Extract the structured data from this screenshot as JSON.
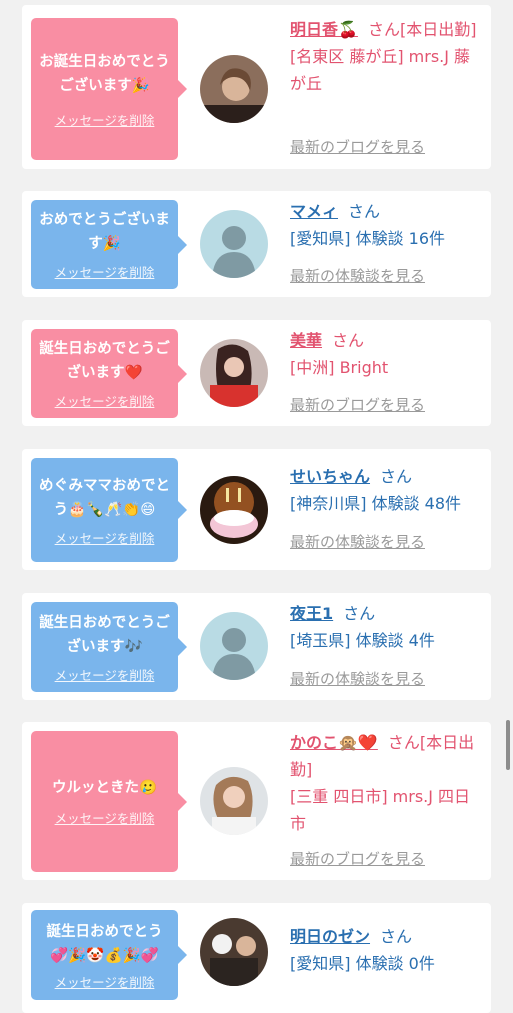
{
  "delete_label": "メッセージを削除",
  "san": "さん",
  "colors": {
    "pink_bubble": "#f98ea3",
    "blue_bubble": "#7ab5ec",
    "pink_text": "#e2536f",
    "blue_text": "#2a6fb0"
  },
  "cards": [
    {
      "message": "お誕生日おめでとうございます🎉",
      "name": "明日香🍒",
      "suffix": "[本日出勤]",
      "detail": "[名東区 藤が丘] mrs.J 藤が丘",
      "latest": "最新のブログを見る"
    },
    {
      "message": "おめでとうございます🎉",
      "name": "マメィ",
      "suffix": "",
      "detail": "[愛知県] 体験談 16件",
      "latest": "最新の体験談を見る",
      "avatar_text": "no photo"
    },
    {
      "message": "誕生日おめでとうございます❤️",
      "name": "美華",
      "suffix": "",
      "detail": "[中洲] Bright",
      "latest": "最新のブログを見る"
    },
    {
      "message": "めぐみママおめでとう🎂🍾🥂👏😄",
      "name": "せいちゃん",
      "suffix": "",
      "detail": "[神奈川県] 体験談 48件",
      "latest": "最新の体験談を見る"
    },
    {
      "message": "誕生日おめでとうございます🎶",
      "name": "夜王1",
      "suffix": "",
      "detail": "[埼玉県] 体験談 4件",
      "latest": "最新の体験談を見る",
      "avatar_text": "no photo"
    },
    {
      "message": "ウルッときた🥲",
      "name": "かのこ🙊❤️",
      "suffix": "[本日出勤]",
      "detail": "[三重 四日市] mrs.J 四日市",
      "latest": "最新のブログを見る"
    },
    {
      "message": "誕生日おめでとう💞🎉🤡💰🎉💞",
      "name": "明日のゼン",
      "suffix": "",
      "detail": "[愛知県] 体験談 0件",
      "latest": ""
    }
  ]
}
